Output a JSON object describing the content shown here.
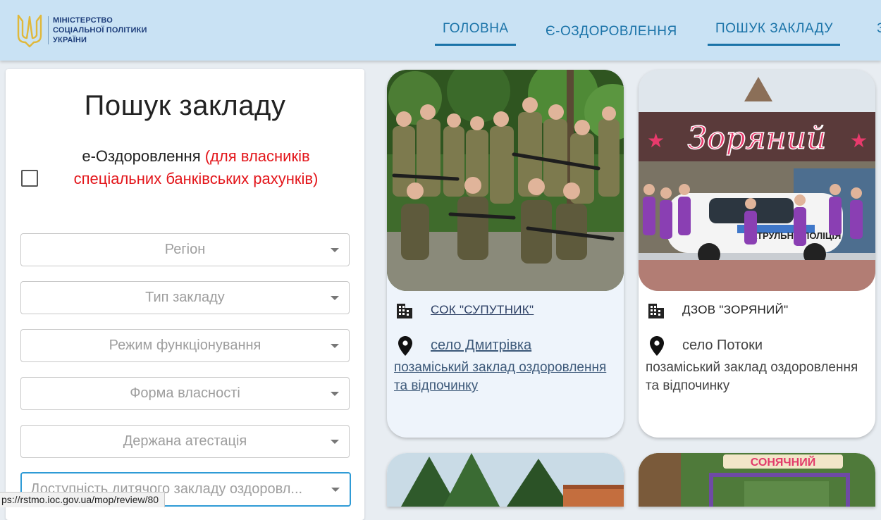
{
  "header": {
    "logo_lines": [
      "МІНІСТЕРСТВО",
      "СОЦІАЛЬНОЇ ПОЛІТИКИ",
      "УКРАЇНИ"
    ],
    "nav": [
      {
        "label": "ГОЛОВНА",
        "active": true
      },
      {
        "label": "Є-ОЗДОРОВЛЕННЯ",
        "active": false
      },
      {
        "label": "ПОШУК ЗАКЛАДУ",
        "active": true
      },
      {
        "label": "З",
        "active": false
      }
    ]
  },
  "filter": {
    "title": "Пошук закладу",
    "eoz_label_main": "е-Оздоровлення ",
    "eoz_label_red": "(для власників спеціальних банківських рахунків)",
    "eoz_checked": false,
    "selects": [
      {
        "placeholder": "Регіон"
      },
      {
        "placeholder": "Тип закладу"
      },
      {
        "placeholder": "Режим функціонування"
      },
      {
        "placeholder": "Форма власності"
      },
      {
        "placeholder": "Держана атестація"
      },
      {
        "placeholder": "Доступність дитячого закладу оздоровл..."
      }
    ]
  },
  "cards": [
    {
      "name": "СОК \"СУПУТНИК\"",
      "place": "село Дмитрівка",
      "type": "позаміський заклад оздоровлення та відпочинку",
      "image_sign": ""
    },
    {
      "name": "ДЗОВ \"ЗОРЯНИЙ\"",
      "place": "село Потоки",
      "type": "позаміський заклад оздоровлення та відпочинку",
      "image_sign": "Зоряний",
      "car_text": "ПАТРУЛЬНА ПОЛІЦІЯ"
    },
    {
      "name": "",
      "place": "",
      "type": ""
    },
    {
      "name": "",
      "place": "",
      "type": "",
      "image_sign": "СОНЯЧНИЙ"
    }
  ],
  "statusbar": {
    "url": "ps://rstmo.ioc.gov.ua/mop/review/80"
  },
  "colors": {
    "header_bg": "#c9e2f4",
    "nav_blue": "#1a73a8",
    "red_text": "#e3161b"
  }
}
